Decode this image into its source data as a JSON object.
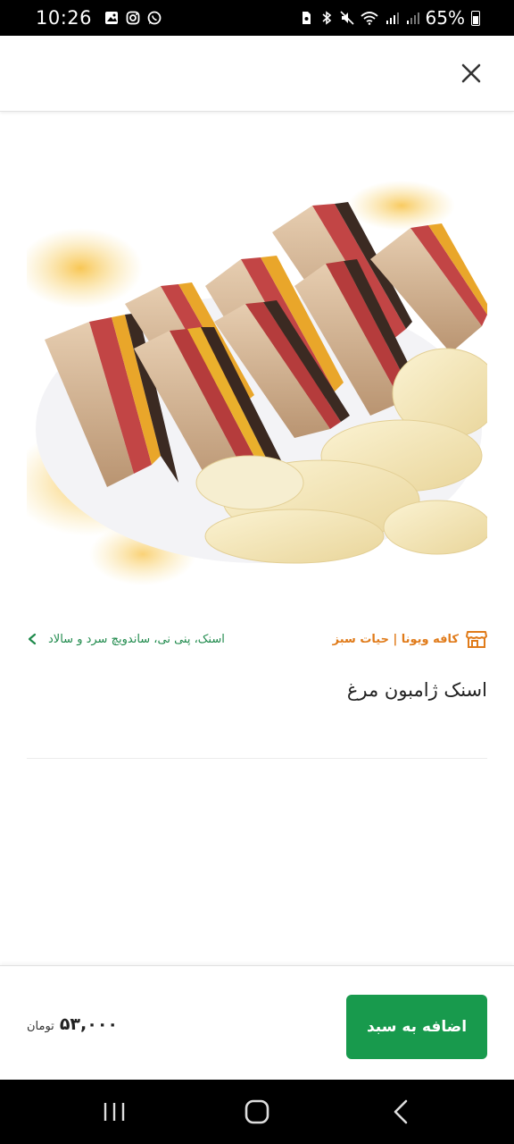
{
  "status_bar": {
    "time": "10:26",
    "battery": "65%",
    "left_icons": [
      "gallery-icon",
      "instagram-icon",
      "whatsapp-icon"
    ],
    "right_icons": [
      "sim-icon",
      "bluetooth-icon",
      "mute-icon",
      "wifi-icon",
      "signal-icon",
      "signal-icon-2",
      "battery-icon"
    ]
  },
  "header": {
    "close_icon": "close-icon"
  },
  "product": {
    "image_alt": "sandwich-with-chips",
    "store_name": "کافه ویونا | حیات سبز",
    "category": "اسنک، پنی نی، ساندویچ سرد و سالاد",
    "title": "اسنک ژامبون مرغ"
  },
  "footer": {
    "price_value": "۵۳,۰۰۰",
    "price_unit": "تومان",
    "add_to_cart_label": "اضافه به سبد"
  },
  "colors": {
    "accent_green": "#189a4d",
    "store_orange": "#e07b1a",
    "breadcrumb_green": "#1f8a4c"
  }
}
